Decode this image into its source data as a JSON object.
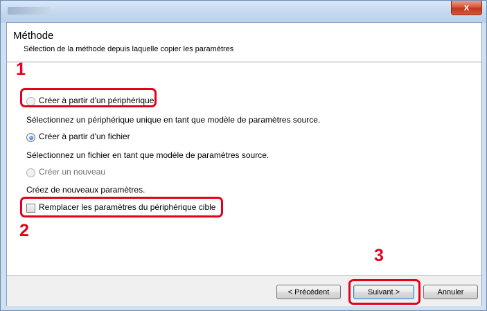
{
  "window": {
    "close_glyph": "x"
  },
  "header": {
    "title": "Méthode",
    "subtitle": "Sélection de la méthode depuis laquelle copier les paramètres"
  },
  "options": {
    "device": {
      "label": "Créer à partir d'un périphérique",
      "description": "Sélectionnez un périphérique unique en tant que modèle de paramètres source.",
      "checked": false
    },
    "file": {
      "label": "Créer à partir d'un fichier",
      "description": "Sélectionnez un fichier en tant que modèle de paramètres source.",
      "checked": true
    },
    "new": {
      "label": "Créer un nouveau",
      "description": "Créez de nouveaux paramètres.",
      "checked": false
    }
  },
  "overwrite": {
    "label": "Remplacer les paramètres du périphérique cible",
    "checked": false
  },
  "buttons": {
    "previous": "< Précédent",
    "next": "Suivant >",
    "cancel": "Annuler"
  },
  "annotations": {
    "step1": "1",
    "step2": "2",
    "step3": "3",
    "highlight_color": "#e4001b"
  }
}
